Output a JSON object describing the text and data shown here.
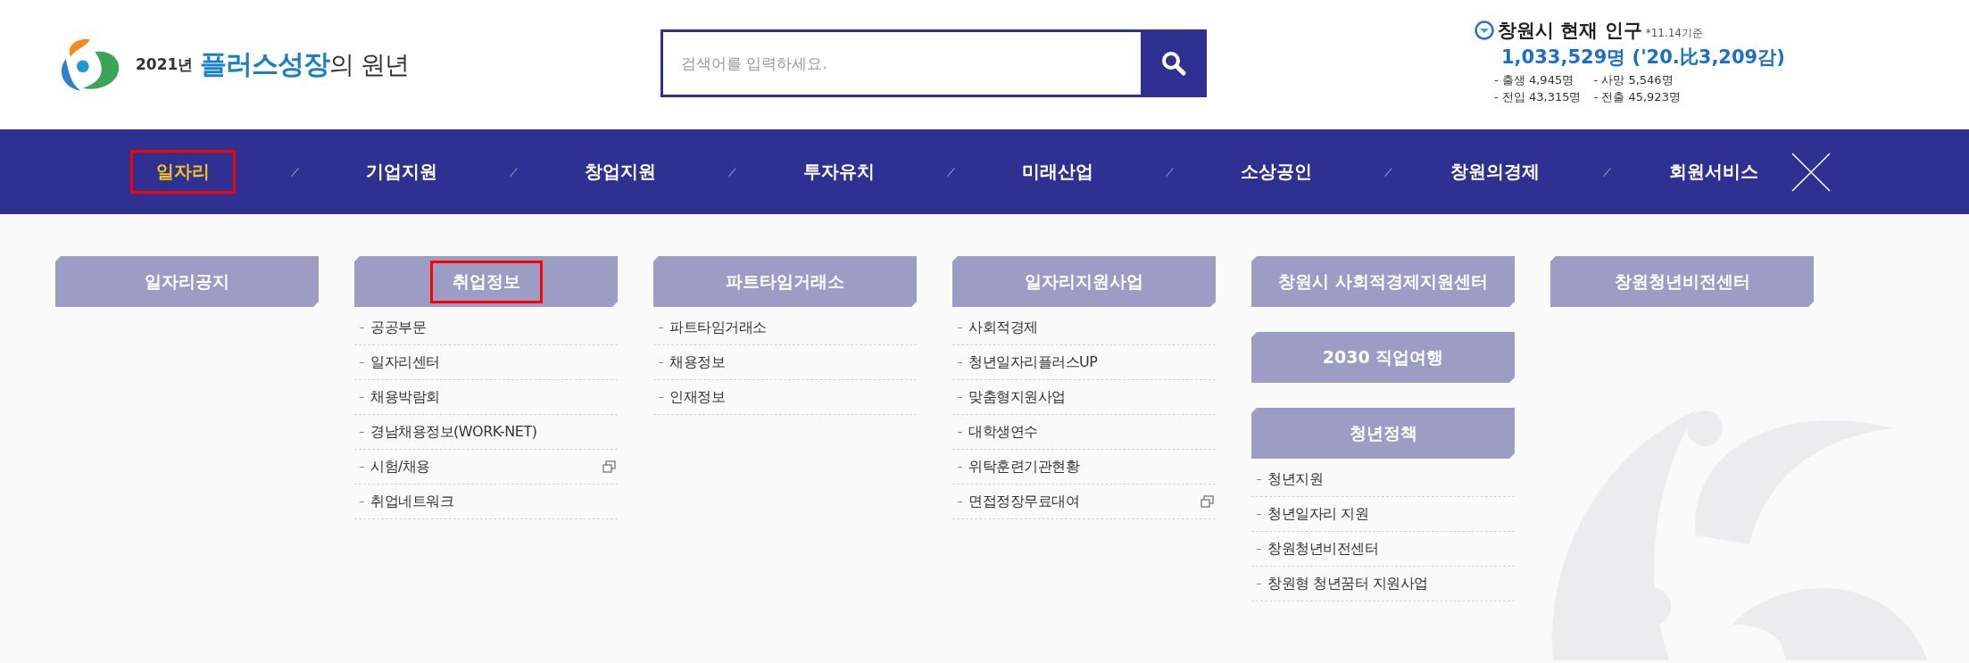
{
  "logo": {
    "year": "2021년",
    "slogan_main": "플러스성장",
    "slogan_rest": "의 원년"
  },
  "search": {
    "placeholder": "검색어를 입력하세요."
  },
  "population": {
    "title": "창원시 현재 인구",
    "note": "*11.14기준",
    "total": "1,033,529명 ('20.比3,209감)",
    "stats": [
      "- 출생 4,945명",
      "- 사망 5,546명",
      "- 전입 43,315명",
      "- 전출 45,923명"
    ]
  },
  "nav": [
    {
      "label": "일자리",
      "selected": true,
      "highlighted": true
    },
    {
      "label": "기업지원",
      "selected": false,
      "highlighted": false
    },
    {
      "label": "창업지원",
      "selected": false,
      "highlighted": false
    },
    {
      "label": "투자유치",
      "selected": false,
      "highlighted": false
    },
    {
      "label": "미래산업",
      "selected": false,
      "highlighted": false
    },
    {
      "label": "소상공인",
      "selected": false,
      "highlighted": false
    },
    {
      "label": "창원의경제",
      "selected": false,
      "highlighted": false
    },
    {
      "label": "회원서비스",
      "selected": false,
      "highlighted": false
    }
  ],
  "columns": [
    {
      "sections": [
        {
          "title": "일자리공지",
          "highlighted": false
        }
      ]
    },
    {
      "sections": [
        {
          "title": "취업정보",
          "highlighted": true,
          "items": [
            {
              "label": "공공부문",
              "external": false
            },
            {
              "label": "일자리센터",
              "external": false
            },
            {
              "label": "채용박람회",
              "external": false
            },
            {
              "label": "경남채용정보(WORK-NET)",
              "external": false
            },
            {
              "label": "시험/채용",
              "external": true
            },
            {
              "label": "취업네트워크",
              "external": false
            }
          ]
        }
      ]
    },
    {
      "sections": [
        {
          "title": "파트타임거래소",
          "highlighted": false,
          "items": [
            {
              "label": "파트타임거래소",
              "external": false
            },
            {
              "label": "채용정보",
              "external": false
            },
            {
              "label": "인재정보",
              "external": false
            }
          ]
        }
      ]
    },
    {
      "sections": [
        {
          "title": "일자리지원사업",
          "highlighted": false,
          "items": [
            {
              "label": "사회적경제",
              "external": false
            },
            {
              "label": "청년일자리플러스UP",
              "external": false
            },
            {
              "label": "맞춤형지원사업",
              "external": false
            },
            {
              "label": "대학생연수",
              "external": false
            },
            {
              "label": "위탁훈련기관현황",
              "external": false
            },
            {
              "label": "면접정장무료대여",
              "external": true
            }
          ]
        }
      ]
    },
    {
      "sections": [
        {
          "title": "창원시 사회적경제지원센터",
          "highlighted": false
        },
        {
          "title": "2030 직업여행",
          "highlighted": false
        },
        {
          "title": "청년정책",
          "highlighted": false,
          "items": [
            {
              "label": "청년지원",
              "external": false
            },
            {
              "label": "청년일자리 지원",
              "external": false
            },
            {
              "label": "창원청년비전센터",
              "external": false
            },
            {
              "label": "창원형 청년꿈터 지원사업",
              "external": false
            }
          ]
        }
      ]
    },
    {
      "sections": [
        {
          "title": "창원청년비전센터",
          "highlighted": false
        }
      ]
    }
  ]
}
